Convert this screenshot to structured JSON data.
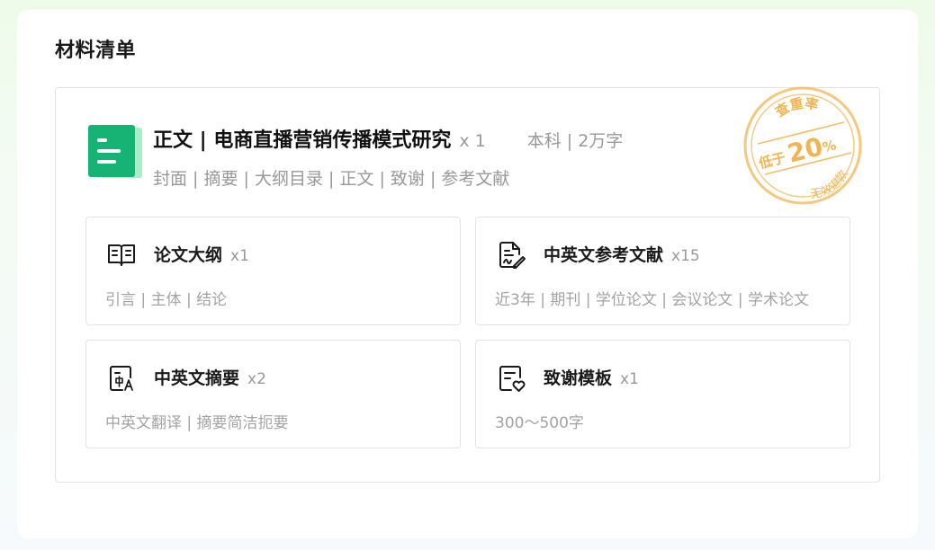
{
  "section": {
    "title": "材料清单"
  },
  "main_item": {
    "icon": "document-icon",
    "title": "正文 | 电商直播营销传播模式研究",
    "quantity": "x 1",
    "meta": "本科 | 2万字",
    "parts": "封面 | 摘要 | 大纲目录 | 正文 | 致谢 | 参考文献"
  },
  "stamp": {
    "top_text": "查重率",
    "prefix": "低于",
    "value": "20",
    "unit": "%",
    "bottom_text": "无效退款",
    "color": "#f0b552"
  },
  "items": [
    {
      "icon": "open-book-icon",
      "title": "论文大纲",
      "quantity": "x1",
      "description": "引言 | 主体 | 结论"
    },
    {
      "icon": "signed-document-icon",
      "title": "中英文参考文献",
      "quantity": "x15",
      "description": "近3年 | 期刊 | 学位论文 | 会议论文 | 学术论文"
    },
    {
      "icon": "translate-document-icon",
      "title": "中英文摘要",
      "quantity": "x2",
      "description": "中英文翻译 | 摘要简洁扼要"
    },
    {
      "icon": "heart-document-icon",
      "title": "致谢模板",
      "quantity": "x1",
      "description": "300～500字"
    }
  ],
  "colors": {
    "brand_green": "#15b374",
    "stamp_orange": "#f0b552"
  }
}
